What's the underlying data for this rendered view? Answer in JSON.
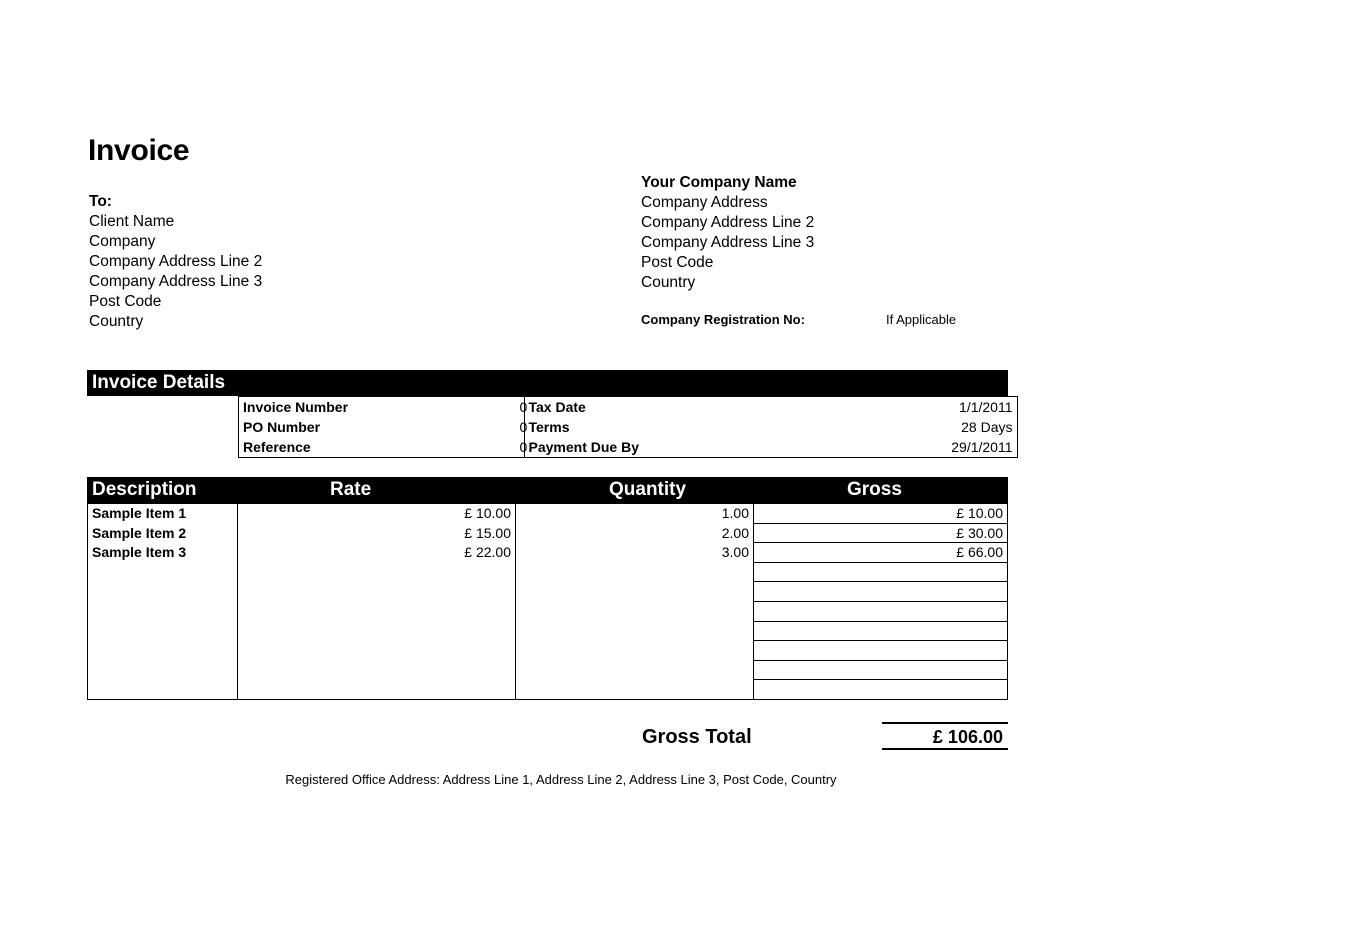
{
  "document": {
    "title": "Invoice"
  },
  "bill_to": {
    "label": "To:",
    "lines": [
      "Client Name",
      "Company",
      "Company Address Line 2",
      "Company Address Line 3",
      "Post Code",
      "Country"
    ]
  },
  "company": {
    "name": "Your Company Name",
    "lines": [
      "Company Address",
      "Company Address Line 2",
      "Company Address Line 3",
      "Post Code",
      "Country"
    ],
    "registration_label": "Company Registration No:",
    "registration_value": "If Applicable"
  },
  "invoice_details": {
    "heading": "Invoice Details",
    "rows": [
      {
        "left_label": "Invoice Number",
        "left_value": "0",
        "right_label": "Tax Date",
        "right_value": "1/1/2011"
      },
      {
        "left_label": "PO Number",
        "left_value": "0",
        "right_label": "Terms",
        "right_value": "28 Days"
      },
      {
        "left_label": "Reference",
        "left_value": "0",
        "right_label": "Payment Due By",
        "right_value": "29/1/2011"
      }
    ]
  },
  "line_items": {
    "columns": [
      "Description",
      "Rate",
      "Quantity",
      "Gross"
    ],
    "rows": [
      {
        "description": "Sample Item 1",
        "rate": "£ 10.00",
        "quantity": "1.00",
        "gross": "£ 10.00"
      },
      {
        "description": "Sample Item 2",
        "rate": "£ 15.00",
        "quantity": "2.00",
        "gross": "£ 30.00"
      },
      {
        "description": "Sample Item 3",
        "rate": "£ 22.00",
        "quantity": "3.00",
        "gross": "£ 66.00"
      },
      {
        "description": "",
        "rate": "",
        "quantity": "",
        "gross": ""
      },
      {
        "description": "",
        "rate": "",
        "quantity": "",
        "gross": ""
      },
      {
        "description": "",
        "rate": "",
        "quantity": "",
        "gross": ""
      },
      {
        "description": "",
        "rate": "",
        "quantity": "",
        "gross": ""
      },
      {
        "description": "",
        "rate": "",
        "quantity": "",
        "gross": ""
      },
      {
        "description": "",
        "rate": "",
        "quantity": "",
        "gross": ""
      },
      {
        "description": "",
        "rate": "",
        "quantity": "",
        "gross": ""
      }
    ]
  },
  "totals": {
    "gross_total_label": "Gross Total",
    "gross_total_value": "£ 106.00"
  },
  "footer": {
    "registered_office": "Registered Office Address: Address Line 1, Address Line 2, Address Line 3, Post Code, Country"
  },
  "colors": {
    "header_bar_background": "#000000",
    "header_bar_text": "#ffffff",
    "page_background": "#ffffff",
    "body_text": "#000000"
  }
}
